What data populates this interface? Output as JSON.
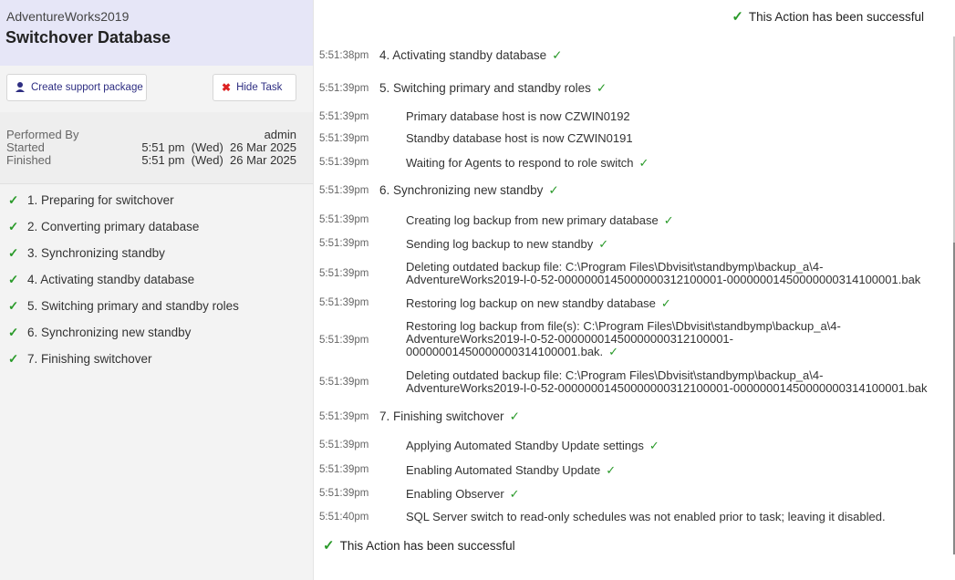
{
  "sidebar": {
    "database": "AdventureWorks2019",
    "title": "Switchover Database",
    "buttons": {
      "support": "Create support package",
      "hide": "Hide Task"
    },
    "info": {
      "performed_by_label": "Performed By",
      "performed_by": "admin",
      "started_label": "Started",
      "started": "5:51 pm  (Wed)  26 Mar 2025",
      "finished_label": "Finished",
      "finished": "5:51 pm  (Wed)  26 Mar 2025"
    },
    "steps": [
      "1. Preparing for switchover",
      "2. Converting primary database",
      "3. Synchronizing standby",
      "4. Activating standby database",
      "5. Switching primary and standby roles",
      "6. Synchronizing new standby",
      "7. Finishing switchover"
    ]
  },
  "log": {
    "success_message": "This Action has been successful",
    "check_mark": "✓",
    "entries": [
      {
        "time": "5:51:38pm",
        "text": "4. Activating standby database"
      },
      {
        "time": "5:51:39pm",
        "text": "5. Switching primary and standby roles"
      },
      {
        "time": "5:51:39pm",
        "text": "Primary database host is now CZWIN0192"
      },
      {
        "time": "5:51:39pm",
        "text": "Standby database host is now CZWIN0191"
      },
      {
        "time": "5:51:39pm",
        "text": "Waiting for Agents to respond to role switch"
      },
      {
        "time": "5:51:39pm",
        "text": "6. Synchronizing new standby"
      },
      {
        "time": "5:51:39pm",
        "text": "Creating log backup from new primary database"
      },
      {
        "time": "5:51:39pm",
        "text": "Sending log backup to new standby"
      },
      {
        "time": "5:51:39pm",
        "text": "Deleting outdated backup file: C:\\Program Files\\Dbvisit\\standbymp\\backup_a\\4-\nAdventureWorks2019-l-0-52-000000014500000031210000​1-00000001450000000314100001.bak"
      },
      {
        "time": "5:51:39pm",
        "text": "Restoring log backup on new standby database"
      },
      {
        "time": "5:51:39pm",
        "text": "Restoring log backup from file(s): C:\\Program Files\\Dbvisit\\standbymp\\backup_a\\4-\nAdventureWorks2019-l-0-52-00000001450000000312100001-\n00000001450000000314100001.bak."
      },
      {
        "time": "5:51:39pm",
        "text": "Deleting outdated backup file: C:\\Program Files\\Dbvisit\\standbymp\\backup_a\\4-\nAdventureWorks2019-l-0-52-00000001450000000312100001-00000001450000000314100001.bak"
      },
      {
        "time": "5:51:39pm",
        "text": "7. Finishing switchover"
      },
      {
        "time": "5:51:39pm",
        "text": "Applying Automated Standby Update settings"
      },
      {
        "time": "5:51:39pm",
        "text": "Enabling Automated Standby Update"
      },
      {
        "time": "5:51:39pm",
        "text": "Enabling Observer"
      },
      {
        "time": "5:51:40pm",
        "text": "SQL Server switch to read-only schedules was not enabled prior to task; leaving it disabled."
      }
    ]
  }
}
